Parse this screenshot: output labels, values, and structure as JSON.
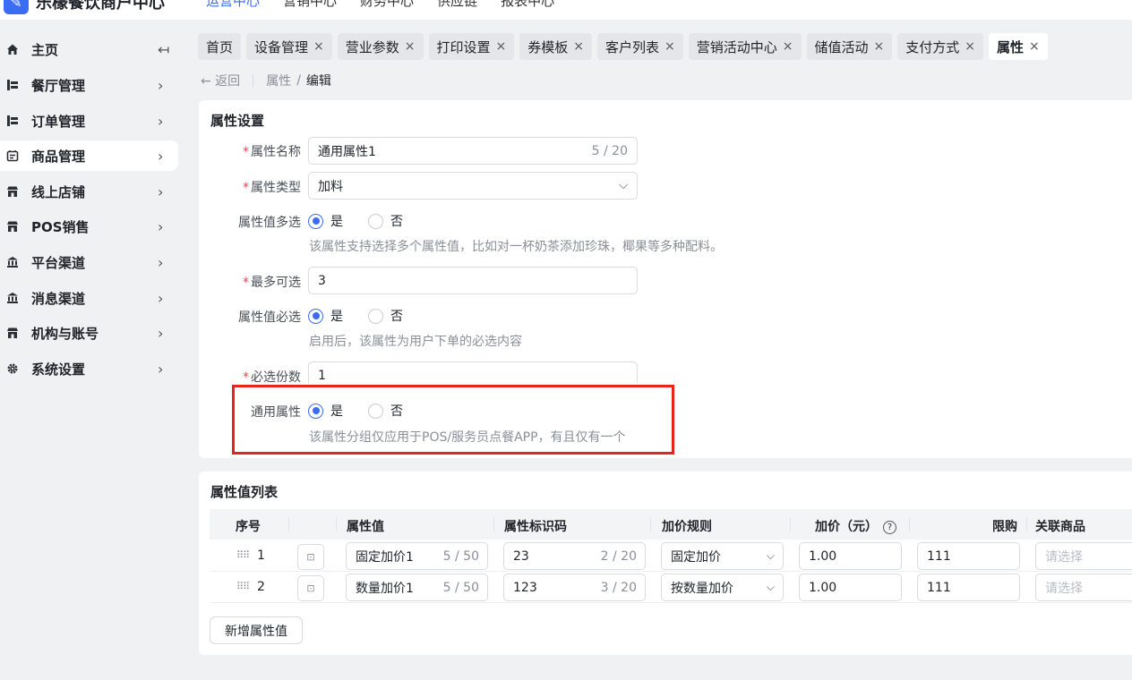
{
  "brand": {
    "name": "乐檬餐饮商户中心"
  },
  "topnav": [
    {
      "label": "运营中心",
      "active": true
    },
    {
      "label": "营销中心"
    },
    {
      "label": "财务中心"
    },
    {
      "label": "供应链"
    },
    {
      "label": "报表中心"
    }
  ],
  "sidebar": {
    "items": [
      {
        "label": "主页",
        "icon": "home-icon",
        "arrow": "↤"
      },
      {
        "label": "餐厅管理",
        "icon": "restaurant-icon",
        "arrow": "›"
      },
      {
        "label": "订单管理",
        "icon": "order-icon",
        "arrow": "›"
      },
      {
        "label": "商品管理",
        "icon": "goods-icon",
        "arrow": "›"
      },
      {
        "label": "线上店铺",
        "icon": "store-icon",
        "arrow": "›"
      },
      {
        "label": "POS销售",
        "icon": "pos-icon",
        "arrow": "›"
      },
      {
        "label": "平台渠道",
        "icon": "bank-icon",
        "arrow": "›"
      },
      {
        "label": "消息渠道",
        "icon": "message-icon",
        "arrow": "›"
      },
      {
        "label": "机构与账号",
        "icon": "org-icon",
        "arrow": "›"
      },
      {
        "label": "系统设置",
        "icon": "gear-icon",
        "arrow": "›"
      }
    ]
  },
  "tabs": [
    {
      "label": "首页"
    },
    {
      "label": "设备管理",
      "close": "×"
    },
    {
      "label": "营业参数",
      "close": "×"
    },
    {
      "label": "打印设置",
      "close": "×"
    },
    {
      "label": "券模板",
      "close": "×"
    },
    {
      "label": "客户列表",
      "close": "×"
    },
    {
      "label": "营销活动中心",
      "close": "×"
    },
    {
      "label": "储值活动",
      "close": "×"
    },
    {
      "label": "支付方式",
      "close": "×"
    },
    {
      "label": "属性",
      "close": "×"
    }
  ],
  "breadcrumb": {
    "back": "← 返回",
    "parent": "属性",
    "slash": "/",
    "current": "编辑"
  },
  "attr_settings": {
    "title": "属性设置",
    "req": "*",
    "name": {
      "label": "属性名称",
      "value": "通用属性1",
      "count": "5 / 20"
    },
    "type": {
      "label": "属性类型",
      "value": "加料",
      "chevron": "⌵"
    },
    "multi": {
      "label": "属性值多选",
      "yes": "是",
      "no": "否",
      "hint": "该属性支持选择多个属性值，比如对一杯奶茶添加珍珠，椰果等多种配料。"
    },
    "max": {
      "label": "最多可选",
      "value": "3"
    },
    "required": {
      "label": "属性值必选",
      "yes": "是",
      "no": "否",
      "hint": "启用后，该属性为用户下单的必选内容"
    },
    "required_count": {
      "label": "必选份数",
      "value": "1"
    },
    "common": {
      "label": "通用属性",
      "yes": "是",
      "no": "否",
      "hint": "该属性分组仅应用于POS/服务员点餐APP，有且仅有一个"
    }
  },
  "value_list": {
    "title": "属性值列表",
    "headers": {
      "seq": "序号",
      "value": "属性值",
      "code": "属性标识码",
      "rule": "加价规则",
      "price": "加价（元）",
      "help": "?",
      "limit": "限购",
      "related": "关联商品"
    },
    "rows": [
      {
        "num": "1",
        "value": "固定加价1",
        "value_count": "5 / 50",
        "code": "23",
        "code_count": "2 / 20",
        "rule": "固定加价",
        "price": "1.00",
        "limit": "111",
        "related_placeholder": "请选择"
      },
      {
        "num": "2",
        "value": "数量加价1",
        "value_count": "5 / 50",
        "code": "123",
        "code_count": "3 / 20",
        "rule": "按数量加价",
        "price": "1.00",
        "limit": "111",
        "related_placeholder": "请选择"
      }
    ],
    "drag_glyph": "⠿⠿",
    "img_glyph": "⊡",
    "chevron": "⌵",
    "add_button": "新增属性值"
  }
}
